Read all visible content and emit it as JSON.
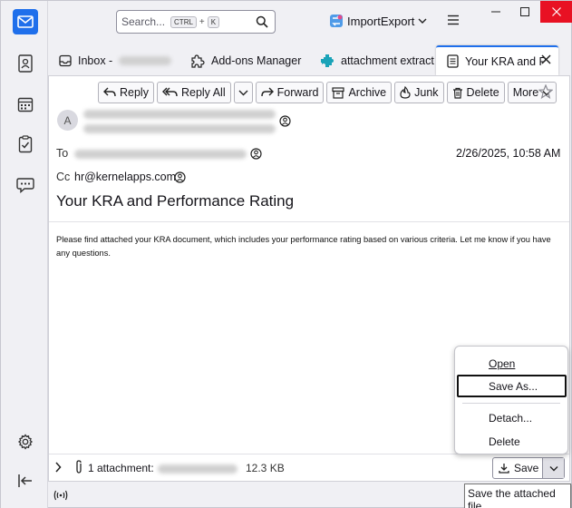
{
  "titlebar": {
    "search_placeholder": "Search...",
    "search_kbd1": "CTRL",
    "search_plus": "+",
    "search_kbd2": "K",
    "account": "ImportExport"
  },
  "tabs": [
    {
      "label": "Inbox -",
      "icon": "inbox-icon"
    },
    {
      "label": "Add-ons Manager",
      "icon": "puzzle-icon"
    },
    {
      "label": "attachment extract",
      "icon": "addon-icon"
    },
    {
      "label": "Your KRA and P",
      "icon": "message-icon"
    }
  ],
  "toolbar": {
    "reply": "Reply",
    "reply_all": "Reply All",
    "forward": "Forward",
    "archive": "Archive",
    "junk": "Junk",
    "delete": "Delete",
    "more": "More"
  },
  "message": {
    "avatar_letter": "A",
    "to_label": "To",
    "cc_label": "Cc",
    "cc_value": "hr@kernelapps.com",
    "date": "2/26/2025, 10:58 AM",
    "subject": "Your KRA and Performance Rating",
    "body": "Please find attached your KRA document, which includes your performance rating based on various criteria. Let me know if you have any questions."
  },
  "attachments": {
    "summary": "1 attachment:",
    "size": "12.3 KB",
    "save": "Save"
  },
  "context_menu": {
    "open": "Open",
    "save_as": "Save As...",
    "detach": "Detach...",
    "delete": "Delete"
  },
  "tooltip": "Save the attached file",
  "colors": {
    "accent": "#1f6feb",
    "close_red": "#e81123"
  }
}
